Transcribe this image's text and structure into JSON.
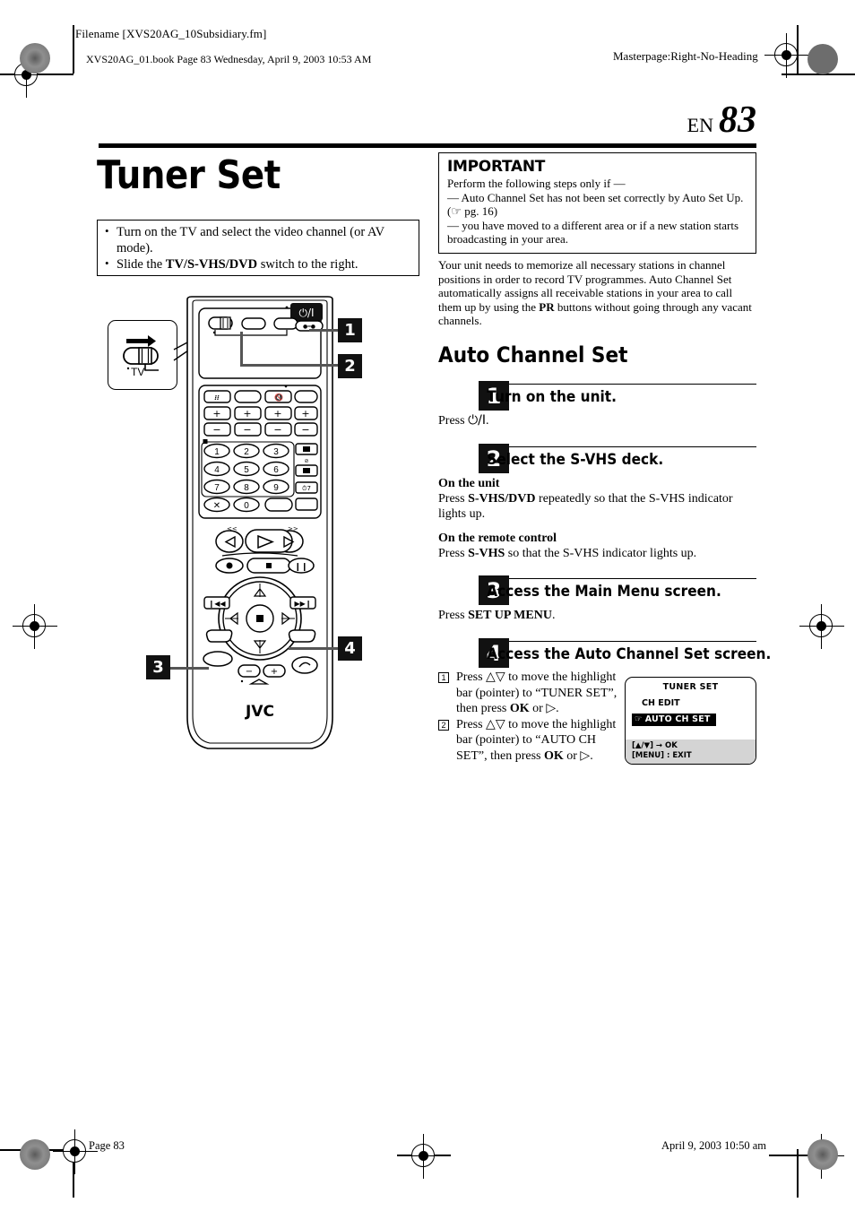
{
  "header": {
    "filename": "Filename [XVS20AG_10Subsidiary.fm]",
    "bookline": "XVS20AG_01.book  Page 83  Wednesday, April 9, 2003  10:53 AM",
    "masterpage": "Masterpage:Right-No-Heading"
  },
  "page": {
    "lang_code": "EN",
    "number": "83",
    "title": "Tuner Set"
  },
  "note_box": {
    "items": [
      "Turn on the TV and select the video channel (or AV mode).",
      "Slide the TV/S-VHS/DVD switch to the right."
    ],
    "item2_pre": "Slide the ",
    "item2_bold": "TV/S-VHS/DVD",
    "item2_post": " switch to the right."
  },
  "important": {
    "heading": "IMPORTANT",
    "line1": "Perform the following steps only if —",
    "line2": "— Auto Channel Set has not been set correctly by Auto Set Up. (",
    "ref_icon": "pointing-hand-icon",
    "line2b": " pg. 16)",
    "line3": "— you have moved to a different area or if a new station starts broadcasting in your area."
  },
  "intro": {
    "part1": "Your unit needs to memorize all necessary stations in channel positions in order to record TV programmes. Auto Channel Set automatically assigns all receivable stations in your area to call them up by using the ",
    "bold": "PR",
    "part2": " buttons without going through any vacant channels."
  },
  "section": {
    "heading": "Auto Channel Set"
  },
  "steps": [
    {
      "number": "1",
      "title": "Turn on the unit.",
      "body_pre": "Press ",
      "body_symbol": "⏻/I",
      "body_post": "."
    },
    {
      "number": "2",
      "title": "Select the S-VHS deck.",
      "sub1_heading": "On the unit",
      "sub1_pre": "Press ",
      "sub1_bold": "S-VHS/DVD",
      "sub1_post": " repeatedly so that the S-VHS indicator lights up.",
      "sub2_heading": "On the remote control",
      "sub2_pre": "Press ",
      "sub2_bold": "S-VHS",
      "sub2_post": " so that the S-VHS indicator lights up."
    },
    {
      "number": "3",
      "title": "Access the Main Menu screen.",
      "body_pre": "Press ",
      "body_bold": "SET UP MENU",
      "body_post": "."
    },
    {
      "number": "4",
      "title": "Access the Auto Channel Set screen.",
      "list": [
        {
          "marker": "1",
          "pre": "Press △▽ to move the highlight bar (pointer) to “TUNER SET”, then press ",
          "bold": "OK",
          "post": " or ▷."
        },
        {
          "marker": "2",
          "pre": "Press △▽ to move the highlight bar (pointer) to “AUTO CH SET”, then press ",
          "bold": "OK",
          "post": " or ▷."
        }
      ]
    }
  ],
  "osd": {
    "title": "TUNER SET",
    "row1": "CH EDIT",
    "highlight_pointer": "☞",
    "highlight_label": "AUTO CH SET",
    "footer_line1": "[▲/▼] → OK",
    "footer_line2": "[MENU] : EXIT"
  },
  "remote": {
    "switch_label": "TV",
    "brand": "JVC",
    "power_label": "⏻/I",
    "keys": [
      "1",
      "2",
      "3",
      "4",
      "5",
      "6",
      "7",
      "8",
      "9",
      "0"
    ],
    "callouts": [
      "1",
      "2",
      "3",
      "4"
    ]
  },
  "footer": {
    "page_label": "Page 83",
    "date": "April 9, 2003 10:50 am"
  }
}
